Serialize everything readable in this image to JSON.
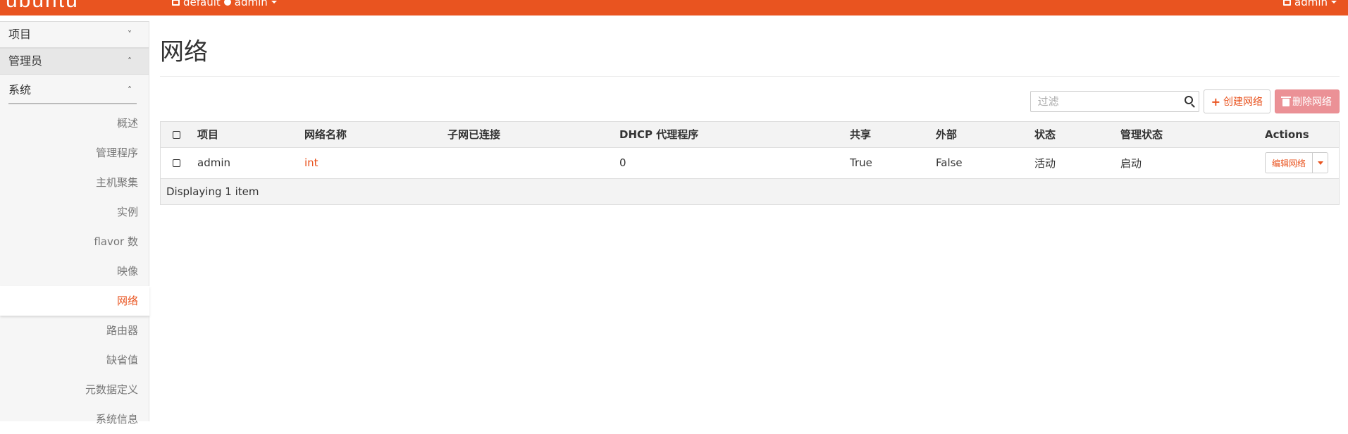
{
  "brand": "ubuntu",
  "header": {
    "project_picker": "default",
    "project_user": "admin",
    "user_menu": "admin"
  },
  "sidebar": {
    "sections": [
      {
        "label": "项目",
        "chevron": "˅"
      },
      {
        "label": "管理员",
        "chevron": "˄"
      }
    ],
    "subsection": {
      "label": "系统",
      "chevron": "˄"
    },
    "items": [
      {
        "label": "概述"
      },
      {
        "label": "管理程序"
      },
      {
        "label": "主机聚集"
      },
      {
        "label": "实例"
      },
      {
        "label": "flavor 数"
      },
      {
        "label": "映像"
      },
      {
        "label": "网络",
        "active": true
      },
      {
        "label": "路由器"
      },
      {
        "label": "缺省值"
      },
      {
        "label": "元数据定义"
      },
      {
        "label": "系统信息"
      }
    ]
  },
  "page": {
    "title": "网络"
  },
  "toolbar": {
    "filter_placeholder": "过滤",
    "create_label": "创建网络",
    "delete_label": "删除网络"
  },
  "table": {
    "columns": [
      "项目",
      "网络名称",
      "子网已连接",
      "DHCP 代理程序",
      "共享",
      "外部",
      "状态",
      "管理状态",
      "Actions"
    ],
    "rows": [
      {
        "project": "admin",
        "name": "int",
        "subnets": "",
        "dhcp_agents": "0",
        "shared": "True",
        "external": "False",
        "status": "活动",
        "admin_state": "启动",
        "action_label": "编辑网络"
      }
    ],
    "footer": "Displaying 1 item"
  },
  "colors": {
    "accent": "#e95420",
    "delete_button": "#eb9196"
  }
}
